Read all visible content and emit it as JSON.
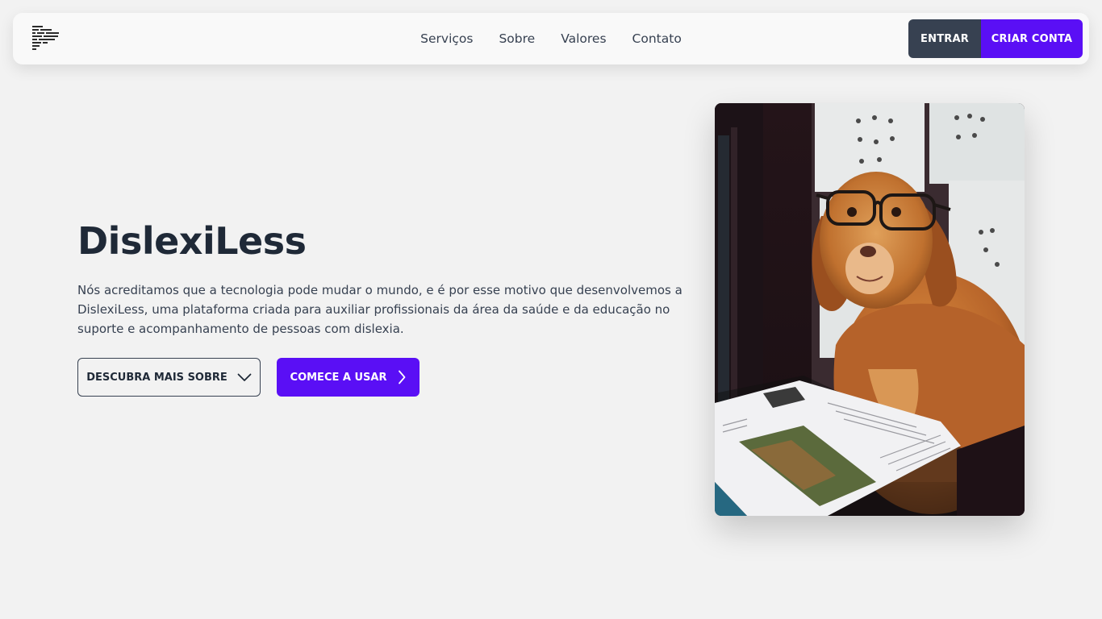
{
  "header": {
    "logo_icon": "text-lines-logo-icon",
    "nav": [
      {
        "label": "Serviços"
      },
      {
        "label": "Sobre"
      },
      {
        "label": "Valores"
      },
      {
        "label": "Contato"
      }
    ],
    "login_label": "ENTRAR",
    "signup_label": "CRIAR CONTA"
  },
  "hero": {
    "title": "DislexiLess",
    "description": "Nós acreditamos que a tecnologia pode mudar o mundo, e é por esse motivo que desenvolvemos a DislexiLess, uma plataforma criada para auxiliar profissionais da área da saúde e da educação no suporte e acompanhamento de pessoas com dislexia.",
    "discover_label": "DESCUBRA MAIS SOBRE",
    "discover_icon": "chevron-down-icon",
    "start_label": "COMECE A USAR",
    "start_icon": "chevron-right-icon",
    "image_subject": "dog-with-glasses-reading-magazine"
  },
  "colors": {
    "background": "#f2f2f2",
    "accent": "#5a0ff5",
    "dark_button": "#374151",
    "text": "#1f2937"
  }
}
